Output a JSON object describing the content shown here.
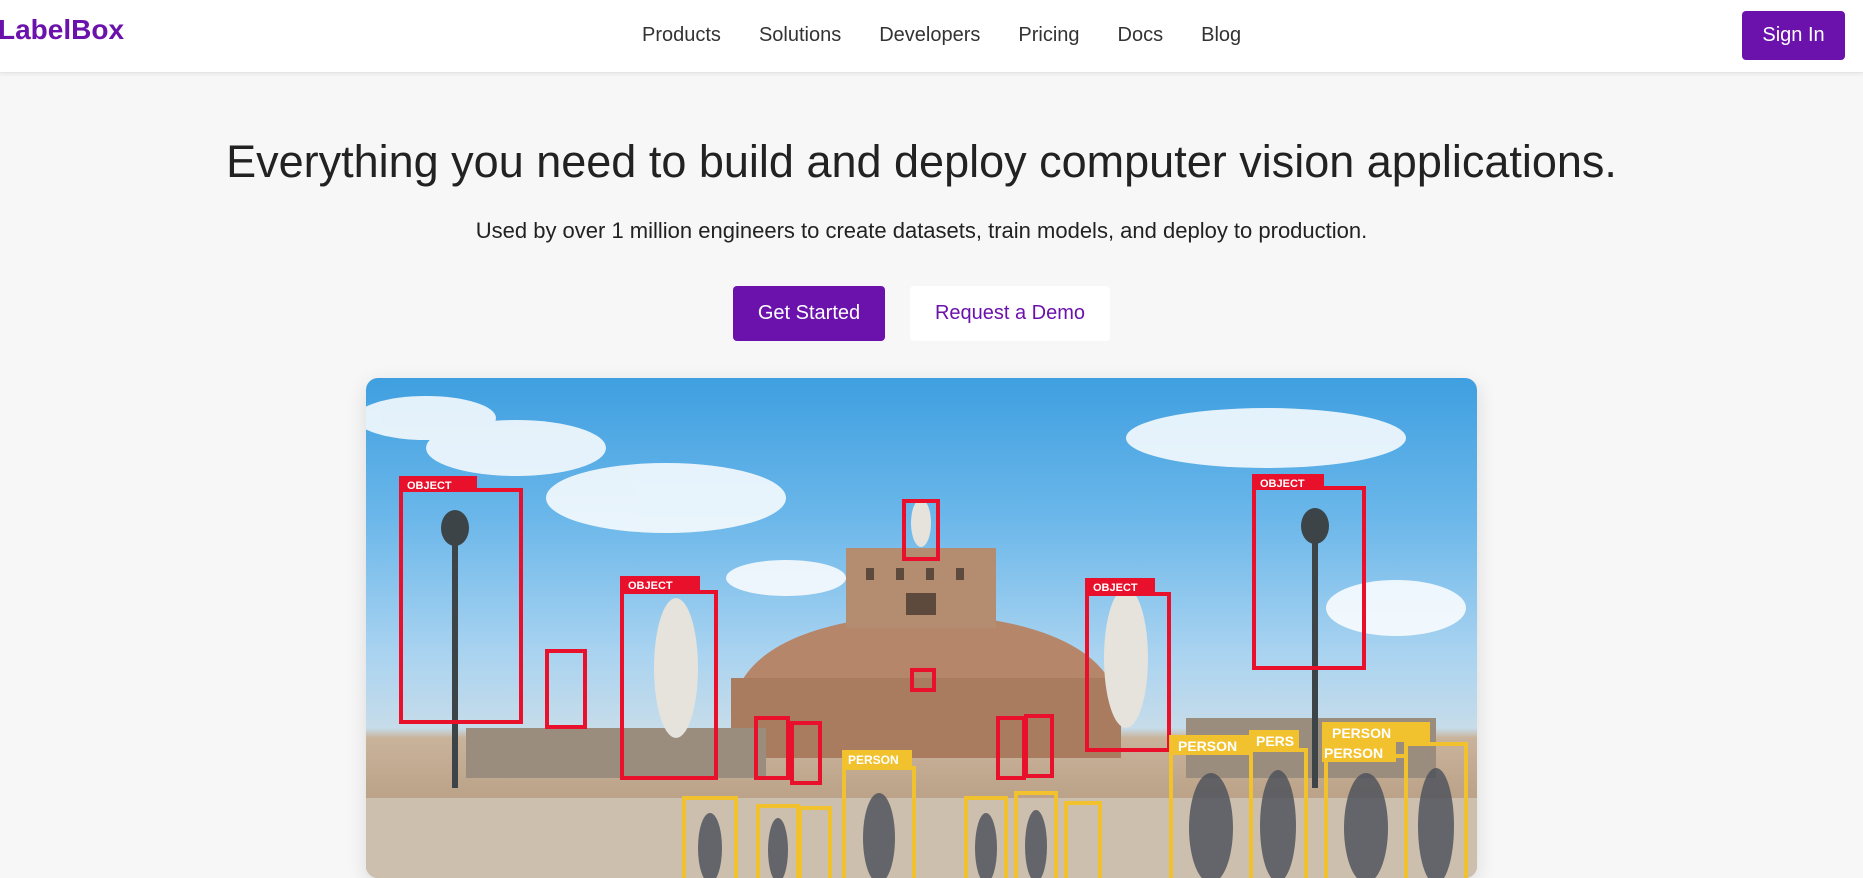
{
  "brand": {
    "name": "LabelBox",
    "color": "#6b12ad"
  },
  "nav": {
    "links": [
      "Products",
      "Solutions",
      "Developers",
      "Pricing",
      "Docs",
      "Blog"
    ],
    "signin_label": "Sign In"
  },
  "hero": {
    "title": "Everything you need to build and deploy computer vision applications.",
    "subtitle": "Used by over 1 million engineers to create datasets, train models, and deploy to production.",
    "primary_cta": "Get Started",
    "secondary_cta": "Request a Demo"
  },
  "showcase": {
    "object_label": "OBJECT",
    "person_label": "PERSON",
    "person_label_truncated": "PERS",
    "object_color": "#e8102a",
    "person_color": "#f2c12e"
  }
}
